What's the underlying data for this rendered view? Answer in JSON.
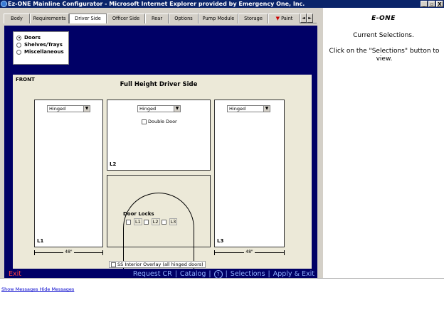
{
  "window": {
    "title": "Ez-ONE Mainline Configurator - Microsoft Internet Explorer provided by Emergency One, Inc.",
    "btn_min": "_",
    "btn_max": "▫",
    "btn_close": "X"
  },
  "tabs": [
    "Body",
    "Requirements",
    "Driver Side",
    "Officer Side",
    "Rear",
    "Options",
    "Pump Module",
    "Storage",
    "Paint"
  ],
  "active_tab": "Driver Side",
  "scroll_left": "◄",
  "scroll_right": "►",
  "options": [
    {
      "label": "Doors",
      "selected": true
    },
    {
      "label": "Shelves/Trays",
      "selected": false
    },
    {
      "label": "Miscellaneous",
      "selected": false
    }
  ],
  "panel": {
    "front_label": "FRONT",
    "title": "Full Height Driver Side",
    "l1": {
      "select": "Hinged",
      "label": "L1",
      "dim": "48\""
    },
    "l2": {
      "select": "Hinged",
      "label": "L2",
      "double_door": "Double Door"
    },
    "l3": {
      "select": "Hinged",
      "label": "L3",
      "dim": "48\""
    },
    "door_locks": {
      "label": "Door Locks",
      "items": [
        "L1",
        "L2",
        "L3"
      ]
    },
    "overlay": "SS Interior Overlay (all hinged doors)"
  },
  "bottom": {
    "exit": "Exit",
    "request": "Request CR",
    "catalog": "Catalog",
    "help": "?",
    "selections": "Selections",
    "apply": "Apply & Exit"
  },
  "right": {
    "logo": "E-ONE",
    "current": "Current Selections.",
    "message": "Click on the \"Selections\" button to view."
  },
  "messages": {
    "show": "Show Messages",
    "hide": "Hide Messages"
  }
}
